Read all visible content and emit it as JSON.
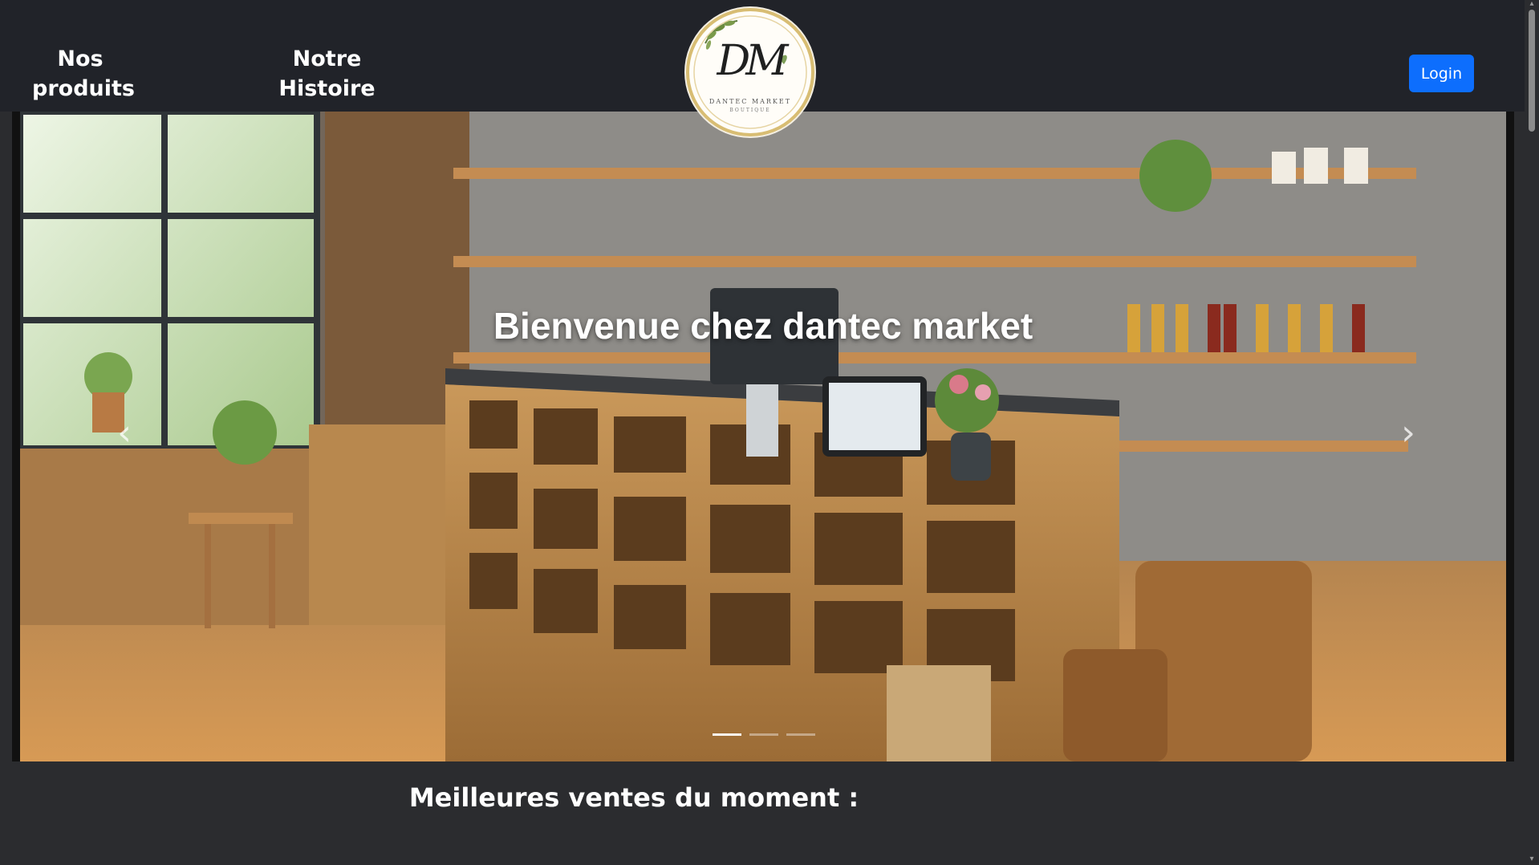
{
  "nav": {
    "products_line1": "Nos",
    "products_line2": "produits",
    "history_line1": "Notre",
    "history_line2": "Histoire",
    "login_label": "Login"
  },
  "logo": {
    "monogram": "DM",
    "name": "DANTEC MARKET",
    "subtitle": "BOUTIQUE"
  },
  "hero": {
    "caption": "Bienvenue chez dantec market",
    "prev_icon": "chevron-left-icon",
    "next_icon": "chevron-right-icon",
    "slides_count": 3,
    "active_slide": 1
  },
  "section": {
    "best_sellers_title": "Meilleures ventes du moment :"
  },
  "colors": {
    "navbar_bg": "#212329",
    "page_bg": "#2b2c2f",
    "login_bg": "#0d6efd",
    "logo_gold": "#d8bd73"
  }
}
